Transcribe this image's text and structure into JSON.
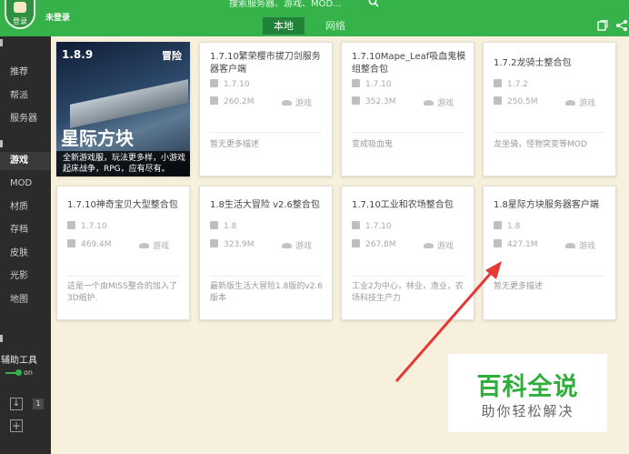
{
  "header": {
    "login_button": "登录",
    "status": "未登录",
    "search_placeholder": "搜索服务器、游戏、MOD...",
    "tabs": [
      {
        "label": "本地",
        "active": true
      },
      {
        "label": "网络",
        "active": false
      }
    ]
  },
  "sidebar": {
    "server_items": [
      "推荐",
      "帮派",
      "服务器"
    ],
    "local_items": [
      "游戏",
      "MOD",
      "材质",
      "存档",
      "皮肤",
      "光影",
      "地图"
    ],
    "active_item": "游戏",
    "tools_label": "辅助工具",
    "toggle_state": "on",
    "download_count": "1"
  },
  "cards": [
    {
      "featured": true,
      "version_badge": "1.8.9",
      "tag": "冒险",
      "name": "星际方块",
      "blurb_line1": "全新游戏服，玩法更多样，小游戏",
      "blurb_line2": "起床战争，RPG，应有尽有。"
    },
    {
      "title": "1.7.10繁荣樱市拔刀剑服务器客户端",
      "version": "1.7.10",
      "size": "260.2M",
      "category": "游戏",
      "desc": "暂无更多描述"
    },
    {
      "title": "1.7.10Mape_Leaf吸血鬼模组整合包",
      "version": "1.7.10",
      "size": "352.3M",
      "category": "游戏",
      "desc": "变成吸血鬼"
    },
    {
      "title": "1.7.2龙骑士整合包",
      "version": "1.7.2",
      "size": "250.5M",
      "category": "游戏",
      "desc": "龙坐骑，怪物突变等MOD"
    },
    {
      "title": "1.7.10神奇宝贝大型整合包",
      "version": "1.7.10",
      "size": "469.4M",
      "category": "游戏",
      "desc": "这是一个由MISS整合的加入了3D缩护."
    },
    {
      "title": "1.8生活大冒险 v2.6整合包",
      "version": "1.8",
      "size": "323.9M",
      "category": "游戏",
      "desc": "最新版生活大冒险1.8版的v2.6版本"
    },
    {
      "title": "1.7.10工业和农场整合包",
      "version": "1.7.10",
      "size": "267.8M",
      "category": "游戏",
      "desc": "工业2为中心，林业，渔业，农场科技生产力"
    },
    {
      "title": "1.8星际方块服务器客户端",
      "version": "1.8",
      "size": "427.1M",
      "category": "游戏",
      "desc": "暂无更多描述"
    }
  ],
  "watermark": {
    "title": "百科全说",
    "subtitle": "助你轻松解决"
  },
  "colors": {
    "brand_green": "#35b34a",
    "sidebar_bg": "#2b2b2b",
    "content_bg": "#f7f0dc",
    "arrow_red": "#e53935"
  }
}
